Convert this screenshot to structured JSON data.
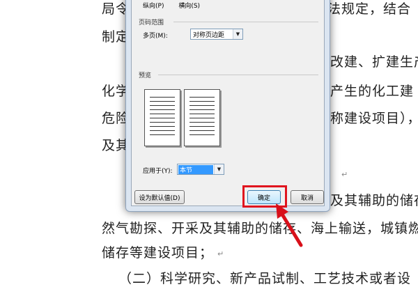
{
  "document": {
    "lines": [
      {
        "left": "局令",
        "right": "法规定，结合"
      },
      {
        "left": "制定",
        "right": ""
      },
      {
        "left": "",
        "right": "改建、扩建生产"
      },
      {
        "left": "化学",
        "right": "产生的化工建"
      },
      {
        "left": "危险",
        "right": "称建设项目），"
      },
      {
        "left": "及其",
        "right": ""
      },
      {
        "left": "",
        "right": "及其辅助的储存"
      },
      {
        "left": "然气勘探、开采及其辅助的储存、海上输送，城镇燃",
        "right": ""
      },
      {
        "left": "储存等建设项目；",
        "right": ""
      },
      {
        "left": "（二）科学研究、新产品试制、工艺技术或者设",
        "right": ""
      }
    ]
  },
  "dialog": {
    "orientation": {
      "portrait": "纵向(P)",
      "landscape": "横向(S)"
    },
    "page_range": {
      "group_label": "页码范围",
      "multi_page_label": "多页(M):",
      "multi_page_value": "对称页边距"
    },
    "preview": {
      "group_label": "预览"
    },
    "apply_to": {
      "label": "应用于(Y):",
      "value": "本节"
    },
    "buttons": {
      "set_default": "设为默认值(D)",
      "ok": "确定",
      "cancel": "取消"
    }
  },
  "colors": {
    "highlight": "#e0141e",
    "dialog_frame": "#dbe5f1",
    "selection": "#3399ff"
  }
}
